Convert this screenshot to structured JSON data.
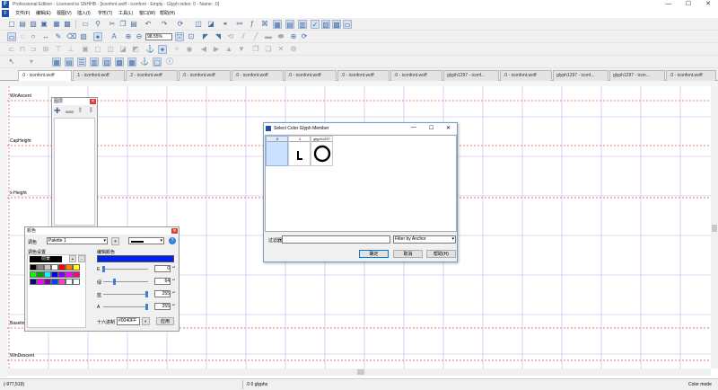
{
  "window": {
    "title": "Professional Edition - Licensed to SNHHB - [iconfont.woff - iconfont - Empty - Glyph index: 0 - Name: .0]",
    "minimize": "—",
    "maximize": "☐",
    "close": "✕"
  },
  "menu": [
    "文件(F)",
    "编辑(E)",
    "视图(V)",
    "插入(I)",
    "字形(T)",
    "工具(L)",
    "窗口(W)",
    "帮助(H)"
  ],
  "tabs": [
    ".0 - iconfont.woff",
    ".1 - iconfont.woff",
    ".2 - iconfont.woff",
    ".0 - iconfont.woff",
    ".0 - iconfont.woff",
    ".0 - iconfont.woff",
    ".0 - iconfont.woff",
    ".0 - iconfont.woff",
    "glyph1297 - iconf...",
    ".0 - iconfont.woff",
    "glyph1297 - iconf...",
    "glyph1297 - icon..."
  ],
  "zoom": "98.55%",
  "guides": {
    "winascent": "WinAscent",
    "capheight": "CapHeight",
    "xheight": "x-Height",
    "baseline": "Baseline",
    "windescent": "WinDescent"
  },
  "colors": {
    "accent": "#0078d7",
    "guide_red": "#e05050",
    "grid_purple": "#c8b4f0",
    "glyph_blue_bar": "#0020f0"
  },
  "layers_panel": {
    "title": "图层"
  },
  "color_panel": {
    "title": "颜色",
    "palette_label": "调色",
    "palette_value": "Palette 1",
    "palette_settings": "调色设置",
    "foreground_label": "前景",
    "edit_color_label": "编辑颜色",
    "channels": [
      {
        "label": "E",
        "value": "0"
      },
      {
        "label": "绿",
        "value": "64"
      },
      {
        "label": "蓝",
        "value": "255"
      },
      {
        "label": "A",
        "value": "255"
      }
    ],
    "hex_label": "十六进制",
    "hex_value": "#0040FF",
    "apply_label": "应用",
    "add": "+",
    "remove": "-",
    "help": "?",
    "swatches": [
      [
        "#000000",
        "#888888",
        "#c8c8c8",
        "#ffffff",
        "#ff0000",
        "#ff8000",
        "#ffff00"
      ],
      [
        "#00ff00",
        "#00a000",
        "#00ffff",
        "#0000ff",
        "#8000ff",
        "#ff00ff",
        "#ff0080"
      ],
      [
        "#000080",
        "#ff00ff",
        "#8000a0",
        "#0040ff",
        "#ff40c0",
        "#ffffff",
        "#ffffff"
      ]
    ]
  },
  "dialog": {
    "title": "Select Color Glyph Member",
    "columns": [
      ".0",
      ".1",
      "glyph1297"
    ],
    "glyph_icons": [
      "",
      "corner-glyph",
      "ring-glyph"
    ],
    "filter_label": "过滤器",
    "filter_value": "",
    "filter_mode": "Filter by Anchor",
    "ok": "确定",
    "cancel": "取消",
    "help": "帮助(H)"
  },
  "status": {
    "coords": "(-977,519)",
    "glyph_info": ".0   0 glyphs",
    "mode": "Color mode"
  }
}
